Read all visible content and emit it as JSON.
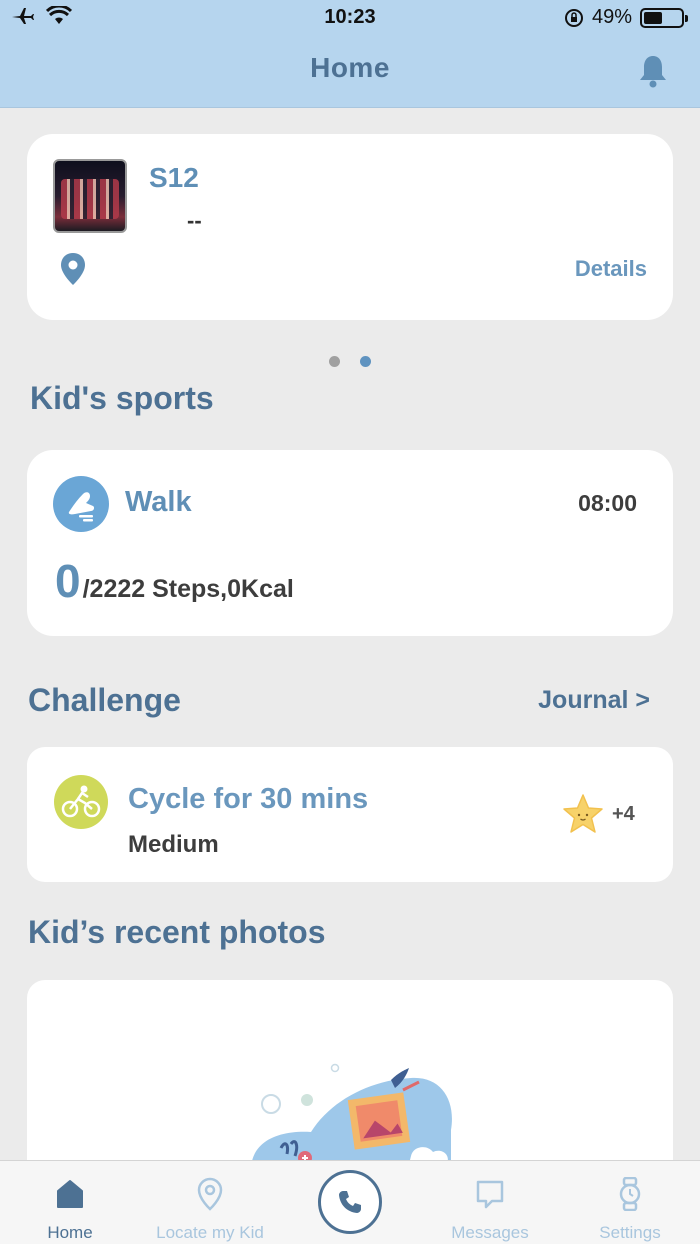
{
  "status_bar": {
    "time": "10:23",
    "battery_percent": "49%",
    "battery_level": 0.49
  },
  "header": {
    "title": "Home"
  },
  "device": {
    "name": "S12",
    "subtitle": "--",
    "details_label": "Details"
  },
  "pager": {
    "count": 2,
    "active_index": 1
  },
  "sports": {
    "title": "Kid's sports",
    "activity": "Walk",
    "time": "08:00",
    "steps_value": "0",
    "steps_text": "/2222 Steps,0Kcal"
  },
  "challenge": {
    "title": "Challenge",
    "journal_label": "Journal >",
    "item_name": "Cycle for 30 mins",
    "item_level": "Medium",
    "item_points": "+4"
  },
  "photos": {
    "title": "Kid’s recent photos"
  },
  "tabbar": {
    "home": "Home",
    "locate": "Locate my Kid",
    "messages": "Messages",
    "settings": "Settings"
  },
  "colors": {
    "header_bg": "#b6d5ee",
    "accent": "#4d7193",
    "accent_light": "#5f8fb6",
    "cycle_icon": "#cfd95a",
    "star": "#f7d26a"
  }
}
